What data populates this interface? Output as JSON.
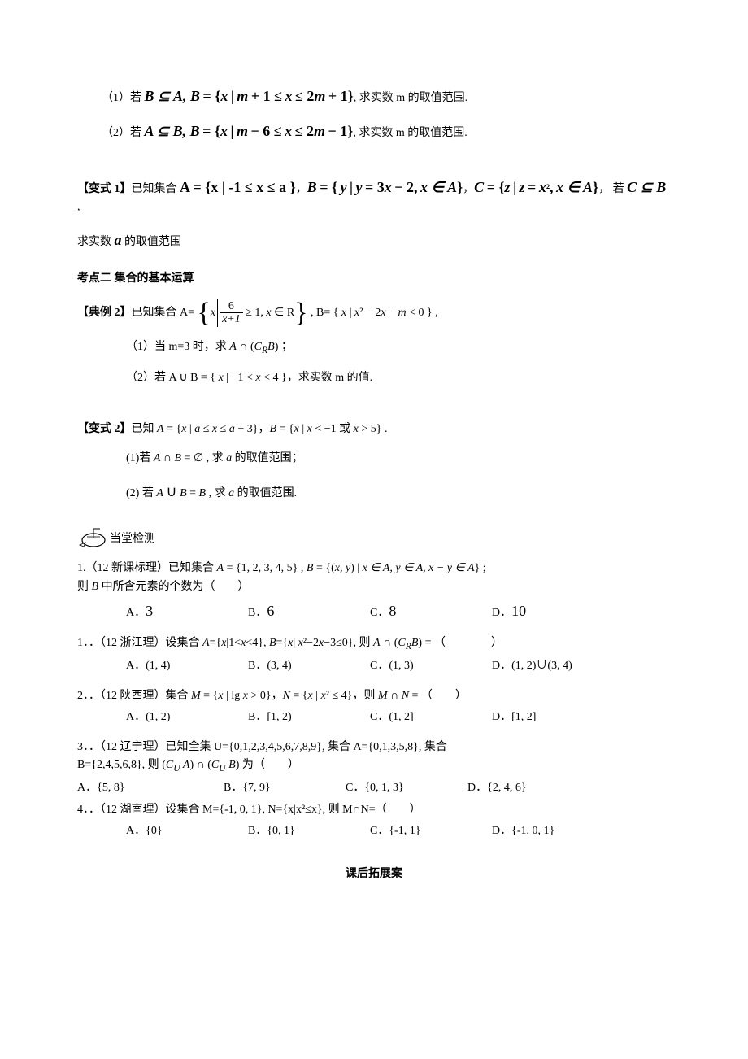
{
  "p1_sub1": "（1）若 B ⊆ A, B = {x | m + 1 ≤ x ≤ 2m + 1}, 求实数 m 的取值范围.",
  "p1_sub2": "（2）若 A ⊆ B, B = {x | m − 6 ≤ x ≤ 2m − 1}, 求实数 m 的取值范围.",
  "var1_label": "【变式 1】",
  "var1_text": "已知集合 A = { x | -1 ≤ x ≤ a }, B = { y | y = 3x − 2, x ∈ A }, C = { z | z = x², x ∈ A }，  若 C ⊆ B ,",
  "var1_tail": "求实数 a 的取值范围",
  "topic2": "考点二  集合的基本运算",
  "ex2_label": "【典例 2】",
  "ex2_pre": "已知集合 A=",
  "ex2_frac_num": "6",
  "ex2_frac_den": "x+1",
  "ex2_frac_right": "≥ 1, x ∈ R",
  "ex2_B": ", B= { x | x² − 2x − m < 0 } ,",
  "ex2_sub1": "（1）当 m=3 时，求 A ∩ (C_R B) ；",
  "ex2_sub2": "（2）若 A ∪ B = { x | −1 < x < 4 }，求实数 m 的值.",
  "var2_label": "【变式 2】",
  "var2_text": "已知 A = {x | a ≤ x ≤ a + 3}，B = {x | x < −1 或 x > 5} .",
  "var2_sub1": "(1)若 A ∩ B = ∅ , 求 a 的取值范围；",
  "var2_sub2": "(2) 若 A ∪ B = B , 求 a 的取值范围.",
  "check_label": "当堂检测",
  "q1_text": "1.（12 新课标理）已知集合 A = {1, 2, 3, 4, 5} , B = {(x, y) | x ∈ A, y ∈ A, x − y ∈ A} ;",
  "q1_then": "则 B 中所含元素的个数为（　　）",
  "q1_A": "A．3",
  "q1_B": "B．6",
  "q1_C": "C．8",
  "q1_D": "D．10",
  "q2_text": "1．．（12 浙江理）设集合 A={x|1<x<4}, B={x| x²−2x−3≤0}, 则 A ∩ (C_R B) = （　　　　）",
  "q2_A": "A．(1, 4)",
  "q2_B": "B．(3, 4)",
  "q2_C": "C．(1, 3)",
  "q2_D": "D．(1, 2)∪(3, 4)",
  "q3_text": "2．．（12 陕西理）集合 M = {x | lg x > 0}，N = {x | x² ≤ 4}，则 M ∩ N = （　　）",
  "q3_A": "A．(1, 2)",
  "q3_B": "B．[1, 2)",
  "q3_C": "C．(1, 2]",
  "q3_D": "D．[1, 2]",
  "q4_text": "3．．（12 辽宁理）已知全集 U={0,1,2,3,4,5,6,7,8,9}, 集合 A={0,1,3,5,8}, 集合",
  "q4_text2": "B={2,4,5,6,8}, 则 (C_U A) ∩ (C_U B) 为（　　）",
  "q4_A": "A．{5, 8}",
  "q4_B": "B．{7, 9}",
  "q4_C": "C．{0, 1, 3}",
  "q4_D": "D．{2, 4, 6}",
  "q5_text": "4．．（12 湖南理）设集合 M={-1, 0, 1}, N={x|x²≤x}, 则 M∩N=（　　）",
  "q5_A": "A．{0}",
  "q5_B": "B．{0, 1}",
  "q5_C": "C．{-1, 1}",
  "q5_D": "D．{-1, 0, 1}",
  "footer": "课后拓展案"
}
